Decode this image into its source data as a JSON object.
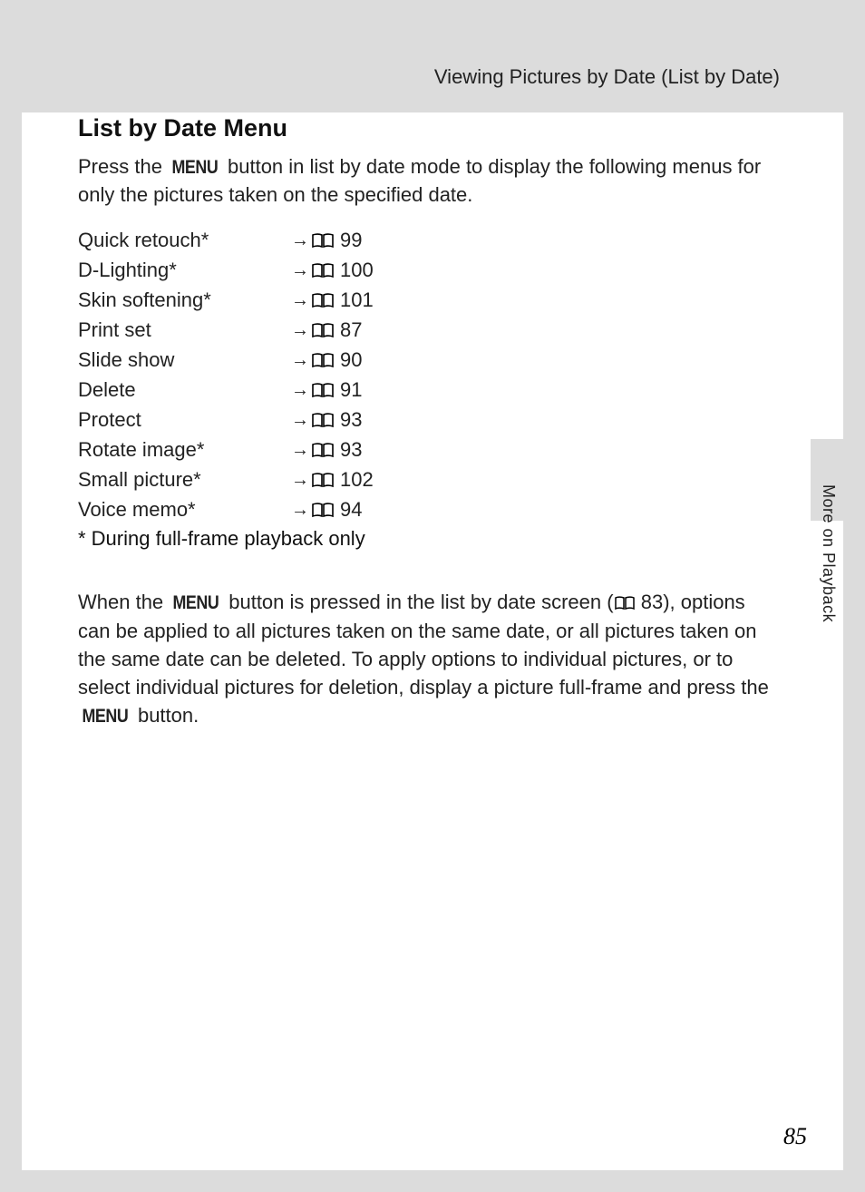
{
  "header": {
    "running_title": "Viewing Pictures by Date (List by Date)"
  },
  "side_tab": "More on Playback",
  "section": {
    "heading": "List by Date Menu",
    "intro_pre": "Press the ",
    "menu_word": "MENU",
    "intro_post": " button in list by date mode to display the following menus for only the pictures taken on the specified date."
  },
  "menu_items": [
    {
      "label": "Quick retouch*",
      "page": "99"
    },
    {
      "label": "D-Lighting*",
      "page": "100"
    },
    {
      "label": "Skin softening*",
      "page": "101"
    },
    {
      "label": "Print set",
      "page": "87"
    },
    {
      "label": "Slide show",
      "page": "90"
    },
    {
      "label": "Delete",
      "page": "91"
    },
    {
      "label": "Protect",
      "page": "93"
    },
    {
      "label": "Rotate image*",
      "page": "93"
    },
    {
      "label": "Small picture*",
      "page": "102"
    },
    {
      "label": "Voice memo*",
      "page": "94"
    }
  ],
  "footnote": "* During full-frame playback only",
  "body2": {
    "t1": "When the ",
    "menu_word": "MENU",
    "t2": " button is pressed in the list by date screen (",
    "ref_page": "83",
    "t3": "), options can be applied to all pictures taken on the same date, or all pictures taken on the same date can be deleted. To apply options to individual pictures, or to select individual pictures for deletion, display a picture full-frame and press the ",
    "menu_word2": "MENU",
    "t4": " button."
  },
  "page_number": "85"
}
